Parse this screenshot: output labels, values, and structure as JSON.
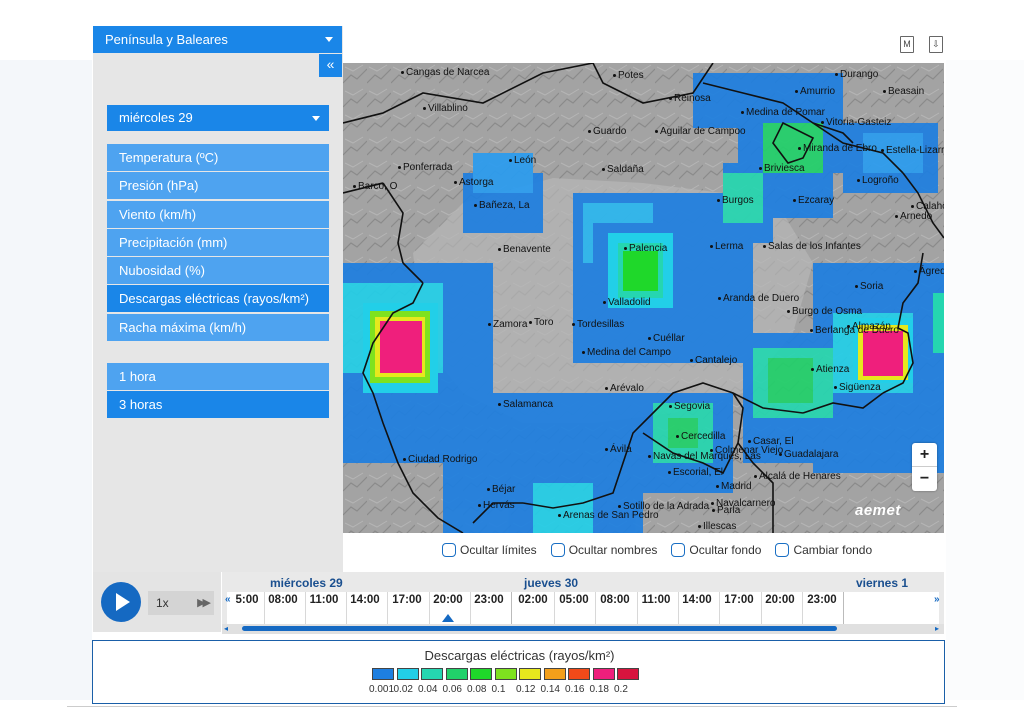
{
  "sidebar": {
    "region": "Península y Baleares",
    "collapse_label": "«",
    "day": "miércoles 29",
    "variables": [
      {
        "label": "Temperatura (ºC)",
        "active": false
      },
      {
        "label": "Presión (hPa)",
        "active": false
      },
      {
        "label": "Viento (km/h)",
        "active": false
      },
      {
        "label": "Precipitación (mm)",
        "active": false
      },
      {
        "label": "Nubosidad (%)",
        "active": false
      },
      {
        "label": "Descargas eléctricas (rayos/km²)",
        "active": true
      },
      {
        "label": "Racha máxima (km/h)",
        "active": false
      }
    ],
    "steps": [
      {
        "label": "1 hora",
        "active": false
      },
      {
        "label": "3 horas",
        "active": true
      }
    ]
  },
  "header_icons": {
    "map_icon": "M",
    "download_icon": "⇩"
  },
  "map": {
    "brand": "aemet",
    "zoom_in": "+",
    "zoom_out": "−",
    "places": [
      "Cangas de Narcea",
      "Villablino",
      "Potes",
      "Reinosa",
      "Durango",
      "Amurrio",
      "Medina de Pomar",
      "Vitoria-Gasteiz",
      "Beasain",
      "Guardo",
      "Aguilar de Campoo",
      "Miranda de Ebro",
      "Estella-Lizarra",
      "Ponferrada",
      "León",
      "Saldaña",
      "Briviesca",
      "Logroño",
      "Barco, O",
      "Astorga",
      "Bañeza, La",
      "Burgos",
      "Ezcaray",
      "Calahorra",
      "Arnedo",
      "Benavente",
      "Palencia",
      "Lerma",
      "Salas de los Infantes",
      "Ágreda",
      "Soria",
      "Valladolid",
      "Aranda de Duero",
      "Zamora",
      "Toro",
      "Tordesillas",
      "Burgo de Osma",
      "Berlanga de Duero",
      "Almazán",
      "Cuéllar",
      "Medina del Campo",
      "Cantalejo",
      "Atienza",
      "Sigüenza",
      "Arévalo",
      "Salamanca",
      "Segovia",
      "Ávila",
      "Cercedilla",
      "Casar, El",
      "Navas del Marqués, Las",
      "Colmenar Viejo",
      "Guadalajara",
      "Escorial, El",
      "Ciudad Rodrigo",
      "Alcalá de Henares",
      "Madrid",
      "Béjar",
      "Hervás",
      "Arenas de San Pedro",
      "Sotillo de la Adrada",
      "Navalcarnero",
      "Parla",
      "Illescas"
    ]
  },
  "options": [
    "Ocultar límites",
    "Ocultar nombres",
    "Ocultar fondo",
    "Cambiar fondo"
  ],
  "player": {
    "speed": "1x",
    "ff": "▶▶"
  },
  "timeline": {
    "days": [
      "miércoles 29",
      "jueves 30",
      "viernes 1"
    ],
    "hours_day1": [
      "5:00",
      "08:00",
      "11:00",
      "14:00",
      "17:00",
      "20:00",
      "23:00"
    ],
    "hours_day2": [
      "02:00",
      "05:00",
      "08:00",
      "11:00",
      "14:00",
      "17:00",
      "20:00",
      "23:00"
    ],
    "selected": "20:00",
    "scroll_left": "◂",
    "scroll_right": "▸"
  },
  "legend": {
    "title": "Descargas eléctricas (rayos/km²)",
    "colors": [
      "#1e7fe0",
      "#22cfe8",
      "#25d6b0",
      "#21d16a",
      "#1fd82a",
      "#7ee21f",
      "#e6e81d",
      "#f39f1a",
      "#f24a19",
      "#ef1f7c",
      "#d7143e"
    ],
    "ticks": [
      "0.001",
      "0.02",
      "0.04",
      "0.06",
      "0.08",
      "0.1",
      "0.12",
      "0.14",
      "0.16",
      "0.18",
      "0.2"
    ]
  }
}
